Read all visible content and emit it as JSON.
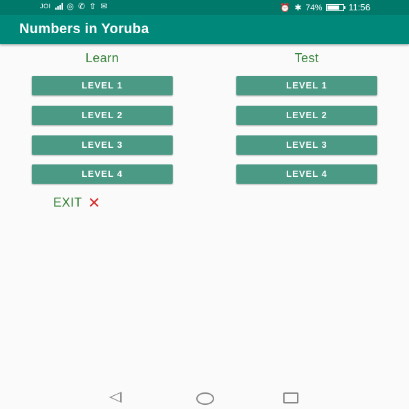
{
  "status_bar": {
    "carrier": "JOI",
    "network": "4G",
    "icons": [
      "signal-icon",
      "hotspot-icon",
      "whatsapp-icon",
      "upload-icon",
      "mail-icon",
      "alarm-icon",
      "bluetooth-icon"
    ],
    "battery": "74%",
    "battery_level": 0.74,
    "time": "11:56"
  },
  "app_bar": {
    "title": "Numbers in Yoruba"
  },
  "learn": {
    "heading": "Learn",
    "levels": [
      "LEVEL 1",
      "LEVEL 2",
      "LEVEL 3",
      "LEVEL 4"
    ]
  },
  "test": {
    "heading": "Test",
    "levels": [
      "LEVEL 1",
      "LEVEL 2",
      "LEVEL 3",
      "LEVEL 4"
    ]
  },
  "exit": {
    "label": "EXIT",
    "icon": "close-icon"
  },
  "colors": {
    "primary": "#00897b",
    "primary_dark": "#00796b",
    "button": "#4a9a86",
    "heading_text": "#2e7d32",
    "exit_icon": "#d32f2f"
  }
}
